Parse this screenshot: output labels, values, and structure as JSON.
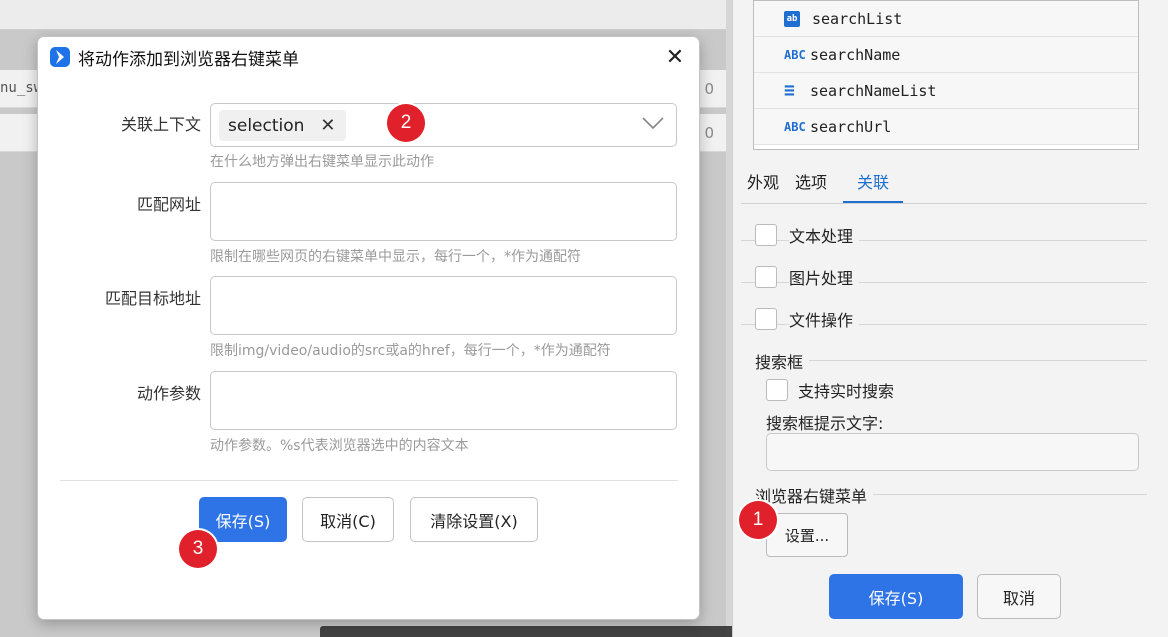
{
  "background": {
    "row1_text": "nu_sw",
    "row1_num": "0",
    "row2_num": "0"
  },
  "right_panel": {
    "list_items": [
      {
        "icon": "ab",
        "label": "searchList"
      },
      {
        "icon": "ABC",
        "label": "searchName"
      },
      {
        "icon": "≡",
        "label": "searchNameList"
      },
      {
        "icon": "ABC",
        "label": "searchUrl"
      }
    ],
    "tabs": [
      "外观",
      "选项",
      "关联"
    ],
    "active_tab": "关联",
    "checkboxes": [
      "文本处理",
      "图片处理",
      "文件操作"
    ],
    "search_section_title": "搜索框",
    "realtime_search_label": "支持实时搜索",
    "search_hint_label": "搜索框提示文字:",
    "search_hint_value": "",
    "context_menu_section_title": "浏览器右键菜单",
    "settings_button": "设置...",
    "save_button": "保存(S)",
    "cancel_button": "取消"
  },
  "modal": {
    "title": "将动作添加到浏览器右键菜单",
    "fields": {
      "context": {
        "label": "关联上下文",
        "tag": "selection",
        "hint": "在什么地方弹出右键菜单显示此动作"
      },
      "match_url": {
        "label": "匹配网址",
        "value": "",
        "hint": "限制在哪些网页的右键菜单中显示，每行一个，*作为通配符"
      },
      "match_target": {
        "label": "匹配目标地址",
        "value": "",
        "hint": "限制img/video/audio的src或a的href，每行一个，*作为通配符"
      },
      "action_params": {
        "label": "动作参数",
        "value": "",
        "hint": "动作参数。%s代表浏览器选中的内容文本"
      }
    },
    "buttons": {
      "save": "保存(S)",
      "cancel": "取消(C)",
      "clear": "清除设置(X)"
    }
  },
  "markers": [
    "1",
    "2",
    "3"
  ],
  "colors": {
    "accent": "#2f74e6",
    "marker": "#e0202a"
  }
}
